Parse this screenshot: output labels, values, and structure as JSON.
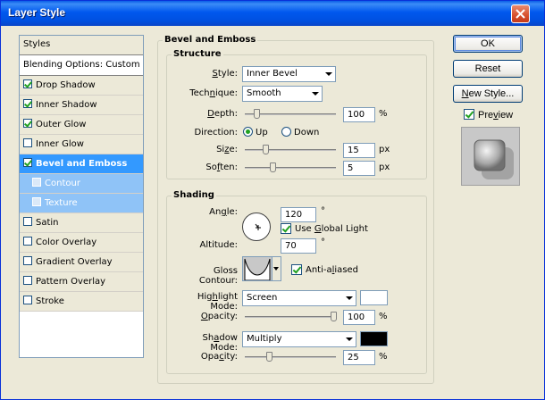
{
  "window": {
    "title": "Layer Style"
  },
  "left_panel": {
    "header": "Styles",
    "blending": "Blending Options: Custom",
    "items": [
      {
        "label": "Drop Shadow",
        "checked": true
      },
      {
        "label": "Inner Shadow",
        "checked": true
      },
      {
        "label": "Outer Glow",
        "checked": true
      },
      {
        "label": "Inner Glow",
        "checked": false
      },
      {
        "label": "Bevel and Emboss",
        "checked": true,
        "selected": true
      },
      {
        "label": "Contour",
        "checked": false,
        "sub": true
      },
      {
        "label": "Texture",
        "checked": false,
        "sub": true
      },
      {
        "label": "Satin",
        "checked": false
      },
      {
        "label": "Color Overlay",
        "checked": false
      },
      {
        "label": "Gradient Overlay",
        "checked": false
      },
      {
        "label": "Pattern Overlay",
        "checked": false
      },
      {
        "label": "Stroke",
        "checked": false
      }
    ]
  },
  "panel": {
    "title": "Bevel and Emboss",
    "structure": {
      "title": "Structure",
      "style_label": "Style:",
      "style_value": "Inner Bevel",
      "technique_label": "Technique:",
      "technique_value": "Smooth",
      "depth_label": "Depth:",
      "depth_value": "100",
      "depth_unit": "%",
      "direction_label": "Direction:",
      "direction_up": "Up",
      "direction_down": "Down",
      "size_label": "Size:",
      "size_value": "15",
      "size_unit": "px",
      "soften_label": "Soften:",
      "soften_value": "5",
      "soften_unit": "px"
    },
    "shading": {
      "title": "Shading",
      "angle_label": "Angle:",
      "angle_value": "120",
      "angle_unit": "°",
      "global_light_label": "Use Global Light",
      "altitude_label": "Altitude:",
      "altitude_value": "70",
      "altitude_unit": "°",
      "gloss_label": "Gloss Contour:",
      "anti_aliased_label": "Anti-aliased",
      "highlight_label": "Highlight Mode:",
      "highlight_value": "Screen",
      "highlight_color": "#ffffff",
      "opacity_label": "Opacity:",
      "opacity_value": "100",
      "opacity_unit": "%",
      "shadow_label": "Shadow Mode:",
      "shadow_value": "Multiply",
      "shadow_color": "#000000",
      "opacity2_label": "Opacity:",
      "opacity2_value": "25",
      "opacity2_unit": "%"
    }
  },
  "buttons": {
    "ok": "OK",
    "reset": "Reset",
    "new_style": "New Style...",
    "preview": "Preview"
  }
}
